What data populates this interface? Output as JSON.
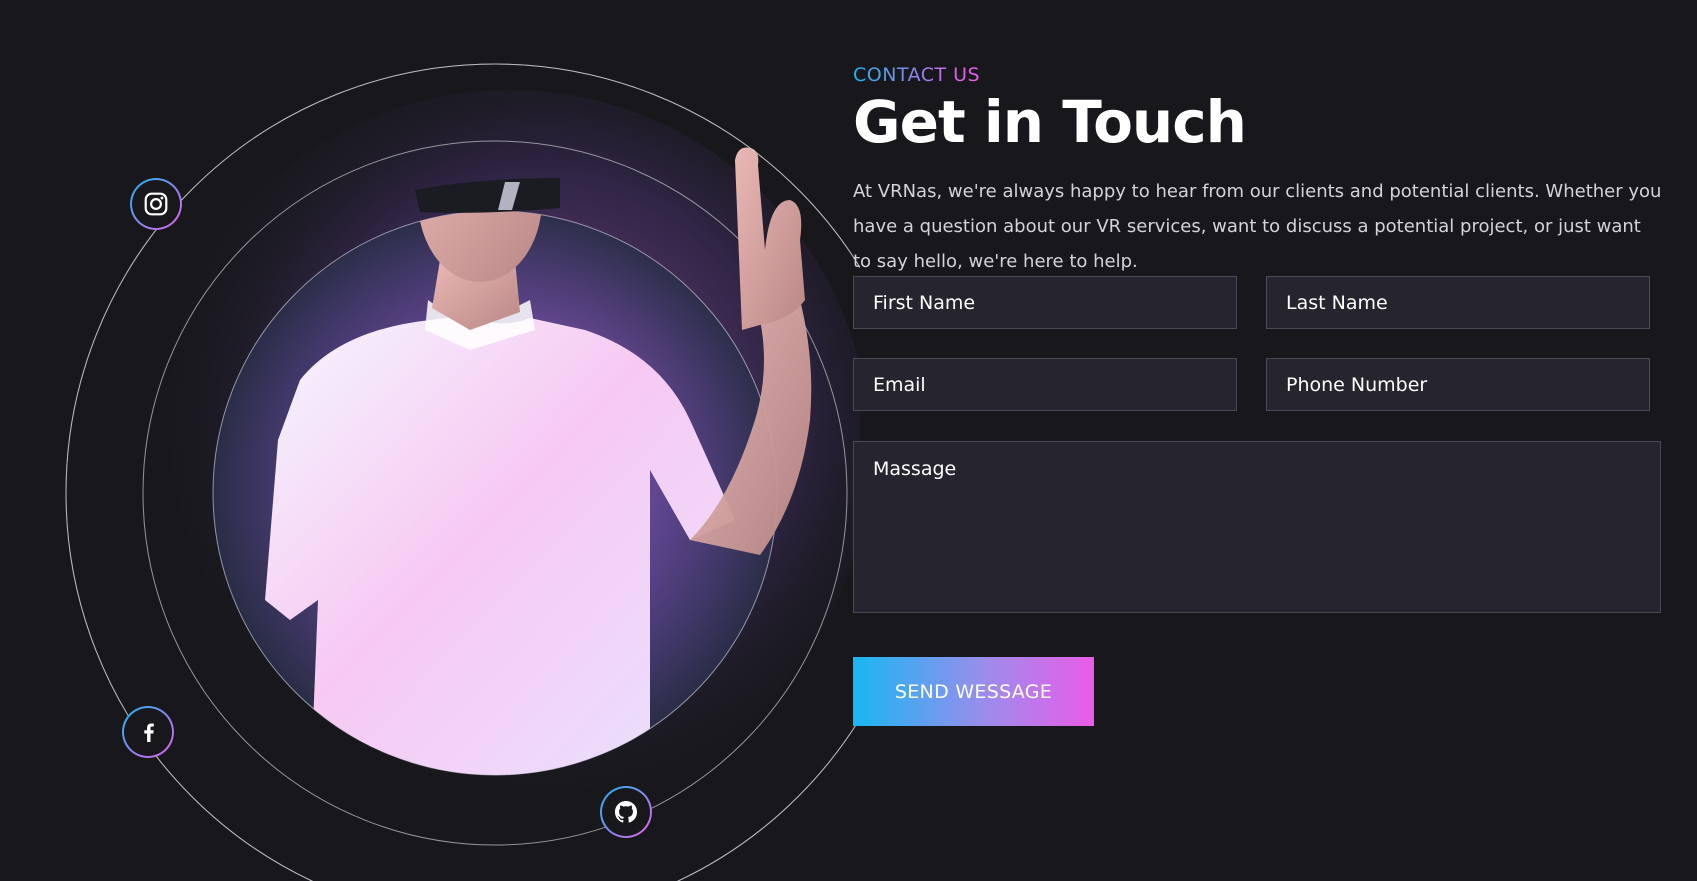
{
  "colors": {
    "background": "#18181c",
    "accent_start": "#1eb4f0",
    "accent_end": "#e35fe6",
    "field_background": "#25242f",
    "text": "#ffffff"
  },
  "social": [
    {
      "name": "instagram",
      "icon": "instagram-icon"
    },
    {
      "name": "facebook",
      "icon": "facebook-icon"
    },
    {
      "name": "github",
      "icon": "github-icon"
    }
  ],
  "header": {
    "eyebrow": "CONTACT US",
    "title": "Get in Touch",
    "intro": "At VRNas, we're always happy to hear from our clients and potential clients. Whether you have a question about our VR services, want to discuss a potential project, or just want to say hello, we're here to help."
  },
  "form": {
    "first_name_placeholder": "First Name",
    "last_name_placeholder": "Last Name",
    "email_placeholder": "Email",
    "phone_placeholder": "Phone Number",
    "message_placeholder": "Massage",
    "submit_label": "SEND WESSAGE"
  }
}
